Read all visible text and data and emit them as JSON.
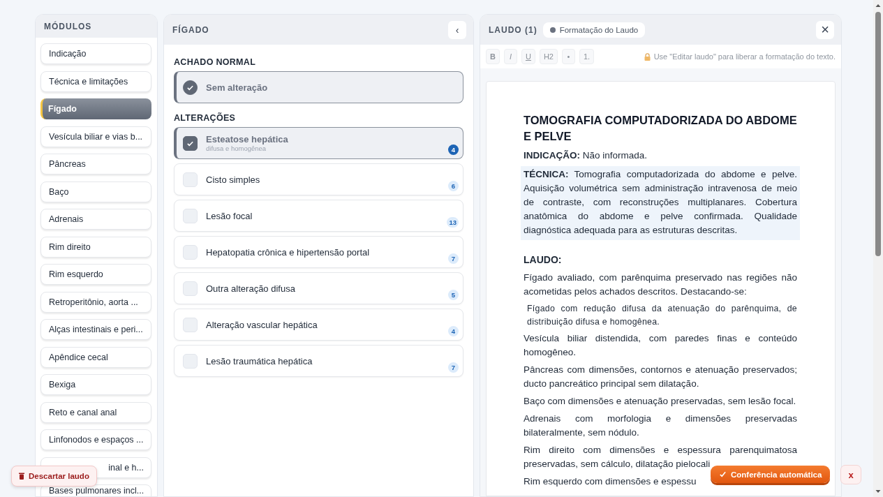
{
  "modules": {
    "title": "MÓDULOS",
    "items": [
      {
        "label": "Indicação",
        "selected": false
      },
      {
        "label": "Técnica e limitações",
        "selected": false
      },
      {
        "label": "Fígado",
        "selected": true
      },
      {
        "label": "Vesícula biliar e vias b...",
        "selected": false
      },
      {
        "label": "Pâncreas",
        "selected": false
      },
      {
        "label": "Baço",
        "selected": false
      },
      {
        "label": "Adrenais",
        "selected": false
      },
      {
        "label": "Rim direito",
        "selected": false
      },
      {
        "label": "Rim esquerdo",
        "selected": false
      },
      {
        "label": "Retroperitônio, aorta ...",
        "selected": false
      },
      {
        "label": "Alças intestinais e peri...",
        "selected": false
      },
      {
        "label": "Apêndice cecal",
        "selected": false
      },
      {
        "label": "Bexiga",
        "selected": false
      },
      {
        "label": "Reto e canal anal",
        "selected": false
      },
      {
        "label": "Linfonodos e espaços ...",
        "selected": false
      },
      {
        "label": "inal e h...",
        "selected": false,
        "kind": "covered"
      },
      {
        "label": "Bases pulmonares incl...",
        "selected": false
      }
    ]
  },
  "findings": {
    "title": "FÍGADO",
    "collapse": "‹",
    "normal_heading": "ACHADO NORMAL",
    "normal": {
      "label": "Sem alteração",
      "checked": true
    },
    "changes_heading": "ALTERAÇÕES",
    "items": [
      {
        "label": "Esteatose hepática",
        "detail": "difusa e homogênea",
        "count": "4",
        "checked": true
      },
      {
        "label": "Cisto simples",
        "count": "6",
        "checked": false
      },
      {
        "label": "Lesão focal",
        "count": "13",
        "checked": false
      },
      {
        "label": "Hepatopatia crônica e hipertensão portal",
        "count": "7",
        "checked": false
      },
      {
        "label": "Outra alteração difusa",
        "count": "5",
        "checked": false
      },
      {
        "label": "Alteração vascular hepática",
        "count": "4",
        "checked": false
      },
      {
        "label": "Lesão traumática hepática",
        "count": "7",
        "checked": false
      }
    ]
  },
  "report": {
    "title": "LAUDO (1)",
    "tab": "Formatação do Laudo",
    "close": "×",
    "toolbar": [
      {
        "label": "B",
        "kind": "bold"
      },
      {
        "label": "I",
        "kind": "italic"
      },
      {
        "label": "U",
        "kind": "underline"
      },
      {
        "label": "H2",
        "kind": "plain"
      },
      {
        "label": "•",
        "kind": "plain"
      },
      {
        "label": "1.",
        "kind": "plain"
      }
    ],
    "toolbar_disabled": true,
    "lock_hint": "Use \"Editar laudo\" para liberar a formatação do texto.",
    "heading": "TOMOGRAFIA COMPUTADORIZADA DO ABDOME E PELVE",
    "blocks": [
      {
        "kind": "field",
        "text": "**INDICAÇÃO:** Não informada.",
        "highlighted": false
      },
      {
        "kind": "field",
        "text": "**TÉCNICA:** Tomografia computadorizada do abdome e pelve. Aquisição volumétrica sem administração intravenosa de meio de contraste, com reconstruções multiplanares. Cobertura anatômica do abdome e pelve confirmada. Qualidade diagnóstica adequada para as estruturas descritas.",
        "highlighted": true
      },
      {
        "kind": "heading",
        "text": "LAUDO:"
      },
      {
        "kind": "paragraph",
        "text": "Fígado avaliado, com parênquima preservado nas regiões não acometidas pelos achados descritos. Destacando-se:"
      },
      {
        "kind": "quote",
        "text": "Fígado com redução difusa da atenuação do parênquima, de distribuição difusa e homogênea."
      },
      {
        "kind": "paragraph",
        "text": "Vesícula biliar distendida, com paredes finas e conteúdo homogêneo."
      },
      {
        "kind": "paragraph",
        "text": "Pâncreas com dimensões, contornos e atenuação preservados; ducto pancreático principal sem dilatação."
      },
      {
        "kind": "paragraph",
        "text": "Baço com dimensões e atenuação preservadas, sem lesão focal."
      },
      {
        "kind": "paragraph",
        "text": "Adrenais com morfologia e dimensões preservadas bilateralmente, sem nódulo."
      },
      {
        "kind": "paragraph",
        "text": "Rim direito com dimensões e espessura parenquimatosa preservadas, sem cálculo, dilatação pielocali"
      },
      {
        "kind": "paragraph",
        "text": "Rim esquerdo com dimensões e espessu"
      }
    ]
  },
  "discard_button": "Descartar laudo",
  "auto_check_button": "Conferência automática",
  "dismiss_button": "x"
}
